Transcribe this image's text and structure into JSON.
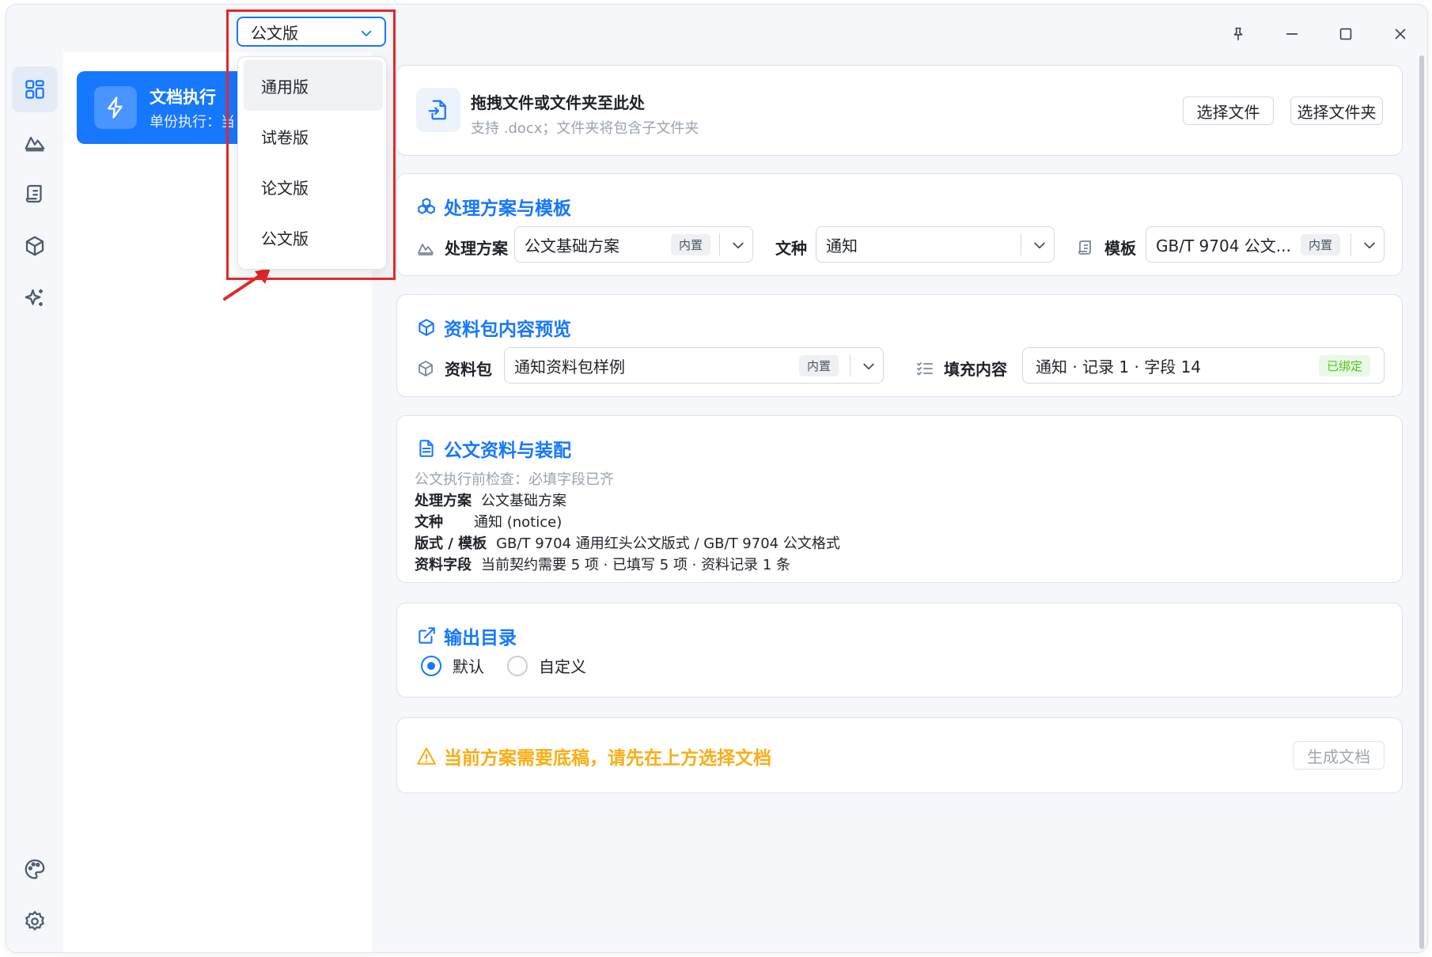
{
  "version_selector": {
    "selected": "公文版",
    "options": [
      "通用版",
      "试卷版",
      "论文版",
      "公文版"
    ]
  },
  "sidebar": {
    "task_title": "文档执行",
    "task_subtitle": "单份执行：当"
  },
  "drop_area": {
    "title": "拖拽文件或文件夹至此处",
    "hint": "支持 .docx；文件夹将包含子文件夹",
    "choose_file": "选择文件",
    "choose_folder": "选择文件夹"
  },
  "plan_section": {
    "title": "处理方案与模板",
    "plan_label": "处理方案",
    "plan_value": "公文基础方案",
    "plan_tag": "内置",
    "doctype_label": "文种",
    "doctype_value": "通知",
    "template_label": "模板",
    "template_value": "GB/T 9704 公文...",
    "template_tag": "内置"
  },
  "package_section": {
    "title": "资料包内容预览",
    "package_label": "资料包",
    "package_value": "通知资料包样例",
    "package_tag": "内置",
    "fill_label": "填充内容",
    "fill_value": "通知 · 记录 1 · 字段 14",
    "fill_status": "已绑定"
  },
  "assembly_section": {
    "title": "公文资料与装配",
    "precheck": "公文执行前检查：必填字段已齐",
    "lines": [
      {
        "key": "处理方案",
        "value": "公文基础方案"
      },
      {
        "key": "文种",
        "value": "通知 (notice)"
      },
      {
        "key": "版式 / 模板",
        "value": "GB/T 9704 通用红头公文版式 / GB/T 9704 公文格式"
      },
      {
        "key": "资料字段",
        "value": "当前契约需要 5 项 · 已填写 5 项 · 资料记录 1 条"
      }
    ]
  },
  "output_section": {
    "title": "输出目录",
    "options": [
      "默认",
      "自定义"
    ],
    "selected": "默认"
  },
  "footer": {
    "warning": "当前方案需要底稿，请先在上方选择文档",
    "generate": "生成文档"
  },
  "colors": {
    "accent": "#1677ff",
    "warning": "#faad14",
    "success": "#52c41a",
    "highlight": "#e5262a"
  }
}
